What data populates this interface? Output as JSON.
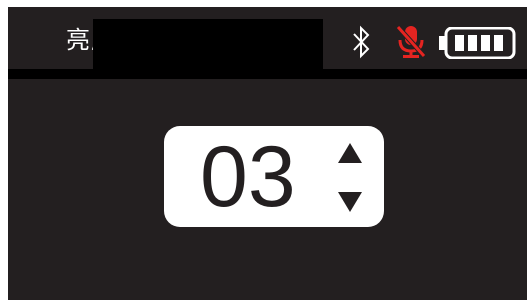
{
  "header": {
    "title": "亮度"
  },
  "status_icons": {
    "bluetooth": "bluetooth-icon",
    "microphone": "microphone-muted-icon",
    "battery": "battery-icon",
    "battery_level": 1.0
  },
  "setting": {
    "value": "03"
  },
  "colors": {
    "screen_background": "#231f20",
    "text": "#ffffff",
    "mic_muted": "#e52421",
    "spinner_background": "#ffffff"
  }
}
